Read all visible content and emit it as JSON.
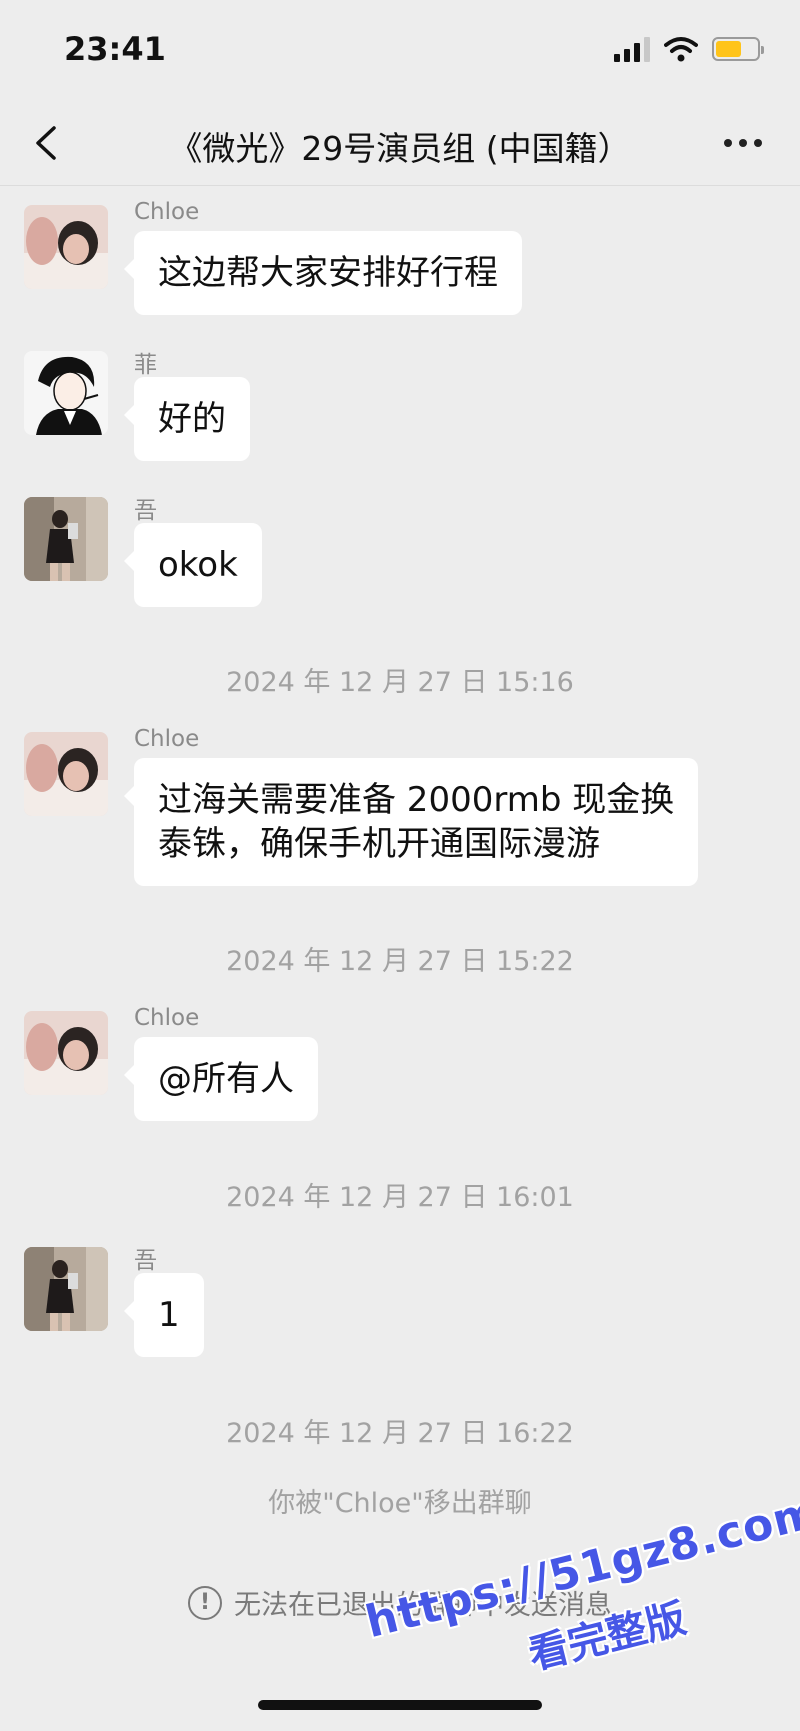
{
  "status_bar": {
    "time": "23:41",
    "battery_color": "#ffc41a"
  },
  "header": {
    "title": "《微光》29号演员组 (中国籍）",
    "back_icon": "chevron-left-icon",
    "more_icon": "more-dots-icon"
  },
  "messages": [
    {
      "sender": "Chloe",
      "text": "这边帮大家安排好行程",
      "avatar": "avatar-chloe"
    },
    {
      "sender": "菲",
      "text": "好的",
      "avatar": "avatar-fei"
    },
    {
      "sender": "吾",
      "text": "okok",
      "avatar": "avatar-wu"
    },
    {
      "sender": "Chloe",
      "text": "过海关需要准备 2000rmb 现金换\n泰铢，确保手机开通国际漫游",
      "avatar": "avatar-chloe"
    },
    {
      "sender": "Chloe",
      "text": "@所有人",
      "avatar": "avatar-chloe"
    },
    {
      "sender": "吾",
      "text": "1",
      "avatar": "avatar-wu"
    }
  ],
  "timestamps": [
    "2024 年 12 月 27 日 15:16",
    "2024 年 12 月 27 日 15:22",
    "2024 年 12 月 27 日 16:01",
    "2024 年 12 月 27 日 16:22"
  ],
  "system_note": "你被\"Chloe\"移出群聊",
  "footer": {
    "notice": "无法在已退出的群聊中发送消息",
    "icon": "info-icon"
  },
  "watermark": {
    "line1": "https://51gz8.com",
    "line2": "看完整版"
  }
}
